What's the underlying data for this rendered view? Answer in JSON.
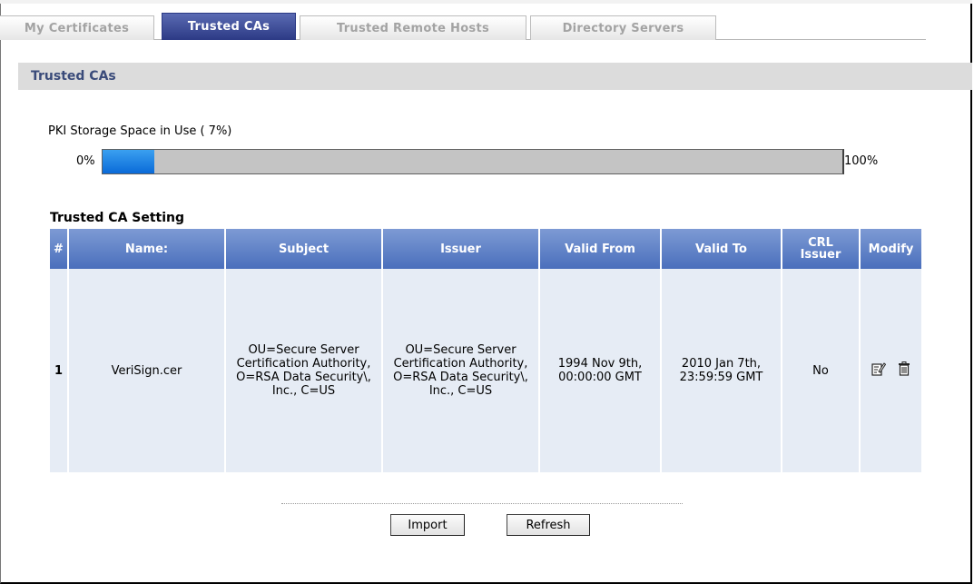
{
  "tabs": [
    {
      "label": "My Certificates",
      "active": false
    },
    {
      "label": "Trusted CAs",
      "active": true
    },
    {
      "label": "Trusted Remote Hosts",
      "active": false
    },
    {
      "label": "Directory Servers",
      "active": false
    }
  ],
  "section_title": "Trusted CAs",
  "storage": {
    "label": "PKI Storage Space in Use ( 7%)",
    "start_label": "0%",
    "end_label": "100%",
    "percent": 7
  },
  "table": {
    "title": "Trusted CA Setting",
    "headers": {
      "index": "#",
      "name": "Name:",
      "subject": "Subject",
      "issuer": "Issuer",
      "valid_from": "Valid From",
      "valid_to": "Valid To",
      "crl_issuer_line1": "CRL",
      "crl_issuer_line2": "Issuer",
      "modify": "Modify"
    },
    "rows": [
      {
        "index": "1",
        "name": "VeriSign.cer",
        "subject": "OU=Secure Server Certification Authority, O=RSA Data Security\\, Inc., C=US",
        "issuer": "OU=Secure Server Certification Authority, O=RSA Data Security\\, Inc., C=US",
        "valid_from": "1994 Nov 9th, 00:00:00 GMT",
        "valid_to": "2010 Jan 7th, 23:59:59 GMT",
        "crl_issuer": "No",
        "modify_icons": [
          "edit-icon",
          "trash-icon"
        ]
      }
    ]
  },
  "buttons": {
    "import": "Import",
    "refresh": "Refresh"
  },
  "colors": {
    "tab_active": "#2c3a85",
    "header_blue": "#4a6fbc",
    "row_bg": "#e6ecf5",
    "progress_fill": "#0a6ad8",
    "section_title": "#3a4b7a"
  }
}
